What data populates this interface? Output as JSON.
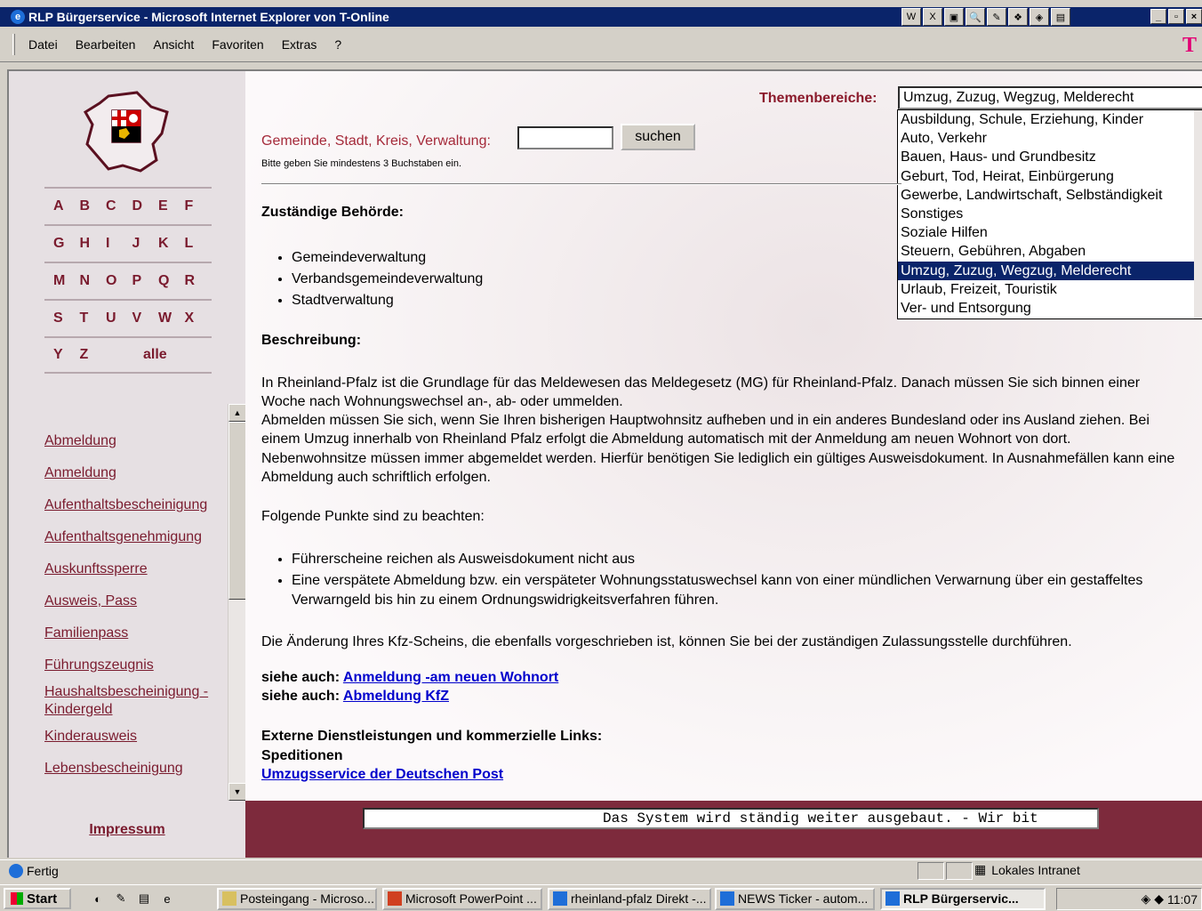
{
  "window": {
    "title": "RLP Bürgerservice - Microsoft Internet Explorer von T-Online",
    "toolbar_icons": [
      "W",
      "X",
      "▣",
      "🔍",
      "✎",
      "❖",
      "◈",
      "▤"
    ],
    "win_buttons": [
      "_",
      "▫",
      "×"
    ]
  },
  "menu": {
    "items": [
      "Datei",
      "Bearbeiten",
      "Ansicht",
      "Favoriten",
      "Extras",
      "?"
    ],
    "brand": "T"
  },
  "sidebar": {
    "letters_rows": [
      [
        "A",
        "B",
        "C",
        "D",
        "E",
        "F"
      ],
      [
        "G",
        "H",
        "I",
        "J",
        "K",
        "L"
      ],
      [
        "M",
        "N",
        "O",
        "P",
        "Q",
        "R"
      ],
      [
        "S",
        "T",
        "U",
        "V",
        "W",
        "X"
      ],
      [
        "Y",
        "Z"
      ]
    ],
    "alle": "alle",
    "topics": [
      "Abmeldung",
      "Anmeldung",
      "Aufenthaltsbescheinigung",
      "Aufenthaltsgenehmigung",
      "Auskunftssperre",
      "Ausweis, Pass",
      "Familienpass",
      "Führungszeugnis",
      "Haushaltsbescheinigung - Kindergeld",
      "Kinderausweis",
      "Lebensbescheinigung"
    ],
    "impressum": "Impressum"
  },
  "search": {
    "label": "Gemeinde, Stadt, Kreis, Verwaltung:",
    "value": "",
    "button": "suchen",
    "hint": "Bitte geben Sie mindestens 3 Buchstaben ein."
  },
  "themen": {
    "label": "Themenbereiche:",
    "selected": "Umzug, Zuzug, Wegzug, Melderecht",
    "options": [
      "Ausbildung, Schule, Erziehung, Kinder",
      "Auto, Verkehr",
      "Bauen, Haus- und Grundbesitz",
      "Geburt, Tod, Heirat, Einbürgerung",
      "Gewerbe, Landwirtschaft, Selbständigkeit",
      "Sonstiges",
      "Soziale Hilfen",
      "Steuern, Gebühren, Abgaben",
      "Umzug, Zuzug, Wegzug, Melderecht",
      "Urlaub, Freizeit, Touristik",
      "Ver- und Entsorgung"
    ],
    "selected_index": 8
  },
  "content": {
    "zustaendig_heading": "Zuständige Behörde:",
    "behoerden": [
      "Gemeindeverwaltung",
      "Verbandsgemeindeverwaltung",
      "Stadtverwaltung"
    ],
    "beschreibung_heading": "Beschreibung:",
    "p1": "In Rheinland-Pfalz ist die Grundlage für das Meldewesen das Meldegesetz (MG) für Rheinland-Pfalz. Danach müssen Sie sich binnen einer Woche nach Wohnungswechsel an-, ab- oder ummelden.",
    "p2": "Abmelden müssen Sie sich, wenn Sie Ihren bisherigen Hauptwohnsitz aufheben und in ein anderes Bundesland oder ins Ausland ziehen. Bei einem Umzug innerhalb von Rheinland Pfalz erfolgt die Abmeldung automatisch mit der Anmeldung am neuen Wohnort von dort. Nebenwohnsitze müssen immer abgemeldet werden. Hierfür benötigen Sie lediglich ein gültiges Ausweisdokument. In Ausnahmefällen kann eine Abmeldung auch schriftlich erfolgen.",
    "p3": "Folgende Punkte sind zu beachten:",
    "points": [
      "Führerscheine reichen als Ausweisdokument nicht aus",
      "Eine verspätete Abmeldung bzw. ein verspäteter Wohnungsstatuswechsel kann von einer mündlichen Verwarnung über ein gestaffeltes Verwarngeld bis hin zu einem Ordnungswidrigkeitsverfahren führen."
    ],
    "p4": "Die Änderung Ihres Kfz-Scheins, die ebenfalls vorgeschrieben ist, können Sie bei der zuständigen Zulassungsstelle durchführen.",
    "siehe_label": "siehe auch:",
    "siehe_links": [
      "Anmeldung -am neuen Wohnort",
      "Abmeldung KfZ"
    ],
    "ext_heading": "Externe Dienstleistungen und kommerzielle Links:",
    "ext_sub": "Speditionen",
    "ext_link": "Umzugsservice der Deutschen Post"
  },
  "ticker": "Das System wird ständig weiter ausgebaut. - Wir bit",
  "status": {
    "text": "Fertig",
    "zone": "Lokales Intranet"
  },
  "taskbar": {
    "start": "Start",
    "tasks": [
      "Posteingang - Microso...",
      "Microsoft PowerPoint ...",
      "rheinland-pfalz Direkt -...",
      "NEWS Ticker - autom...",
      "RLP Bürgerservic..."
    ],
    "clock": "11:07"
  }
}
